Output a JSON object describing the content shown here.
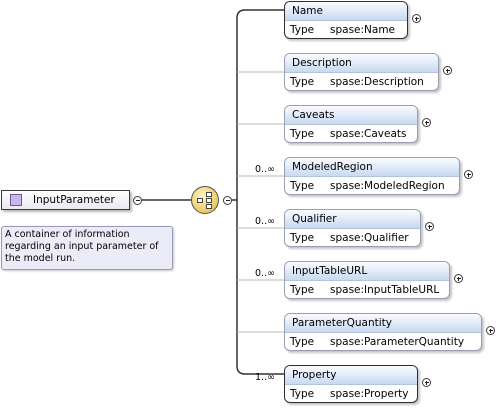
{
  "root": {
    "name": "InputParameter",
    "documentation": [
      "A container of information",
      "regarding an input parameter of",
      "the model run."
    ]
  },
  "type_key": "Type",
  "children": [
    {
      "name": "Name",
      "type": "spase:Name",
      "occurs": "",
      "required": true
    },
    {
      "name": "Description",
      "type": "spase:Description",
      "occurs": "",
      "required": false
    },
    {
      "name": "Caveats",
      "type": "spase:Caveats",
      "occurs": "",
      "required": false
    },
    {
      "name": "ModeledRegion",
      "type": "spase:ModeledRegion",
      "occurs": "0..∞",
      "required": false
    },
    {
      "name": "Qualifier",
      "type": "spase:Qualifier",
      "occurs": "0..∞",
      "required": false
    },
    {
      "name": "InputTableURL",
      "type": "spase:InputTableURL",
      "occurs": "0..∞",
      "required": false
    },
    {
      "name": "ParameterQuantity",
      "type": "spase:ParameterQuantity",
      "occurs": "",
      "required": false
    },
    {
      "name": "Property",
      "type": "spase:Property",
      "occurs": "1..∞",
      "required": true
    }
  ]
}
